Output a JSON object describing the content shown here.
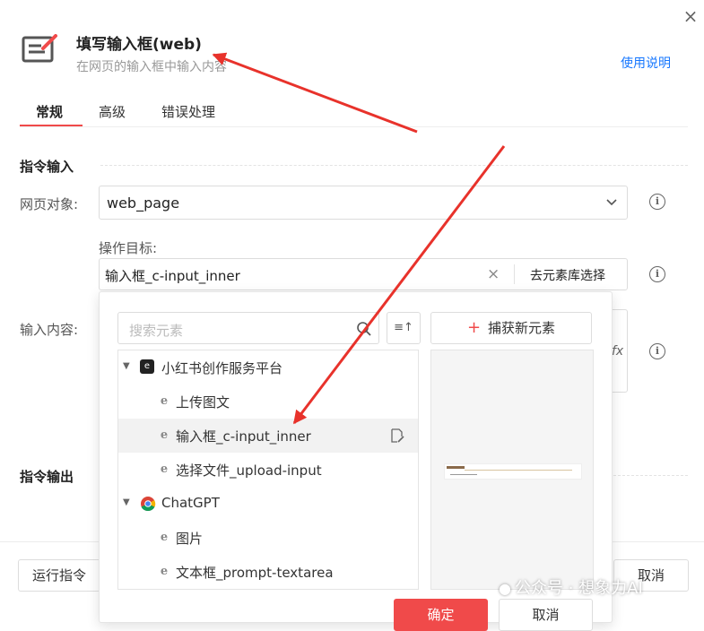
{
  "dialog": {
    "title": "填写输入框(web)",
    "subtitle": "在网页的输入框中输入内容",
    "help_link": "使用说明",
    "close_icon": "×"
  },
  "tabs": [
    {
      "label": "常规",
      "active": true
    },
    {
      "label": "高级",
      "active": false
    },
    {
      "label": "错误处理",
      "active": false
    }
  ],
  "instruction_input": {
    "section_title": "指令输入",
    "web_object": {
      "label": "网页对象:",
      "value": "web_page"
    },
    "operation_target": {
      "label": "操作目标:",
      "value": "输入框_c-input_inner",
      "library_button": "去元素库选择"
    },
    "input_content": {
      "label": "输入内容:",
      "clear_icon": "fx"
    }
  },
  "instruction_output": {
    "section_title": "指令输出"
  },
  "element_picker": {
    "search_placeholder": "搜索元素",
    "sort_icon": "≡↑",
    "capture_button": {
      "plus": "+",
      "label": "捕获新元素"
    },
    "tree": [
      {
        "type": "group",
        "label": "小红书创作服务平台",
        "icon": "xiaohongshu-logo"
      },
      {
        "type": "item",
        "label": "上传图文",
        "icon": "ie-icon"
      },
      {
        "type": "item",
        "label": "输入框_c-input_inner",
        "icon": "ie-icon",
        "selected": true
      },
      {
        "type": "item",
        "label": "选择文件_upload-input",
        "icon": "ie-icon"
      },
      {
        "type": "group",
        "label": "ChatGPT",
        "icon": "chrome-icon"
      },
      {
        "type": "item",
        "label": "图片",
        "icon": "ie-icon"
      },
      {
        "type": "item",
        "label": "文本框_prompt-textarea",
        "icon": "ie-icon"
      }
    ],
    "confirm_button": "确定",
    "cancel_button": "取消"
  },
  "footer": {
    "run_button": "运行指令",
    "cancel_button": "取消"
  },
  "watermark": "公众号 · 想象力AI",
  "colors": {
    "accent": "#f04a4a",
    "link": "#1677ff",
    "arrow": "#e8322b",
    "selected_row": "#f2f2f2"
  }
}
